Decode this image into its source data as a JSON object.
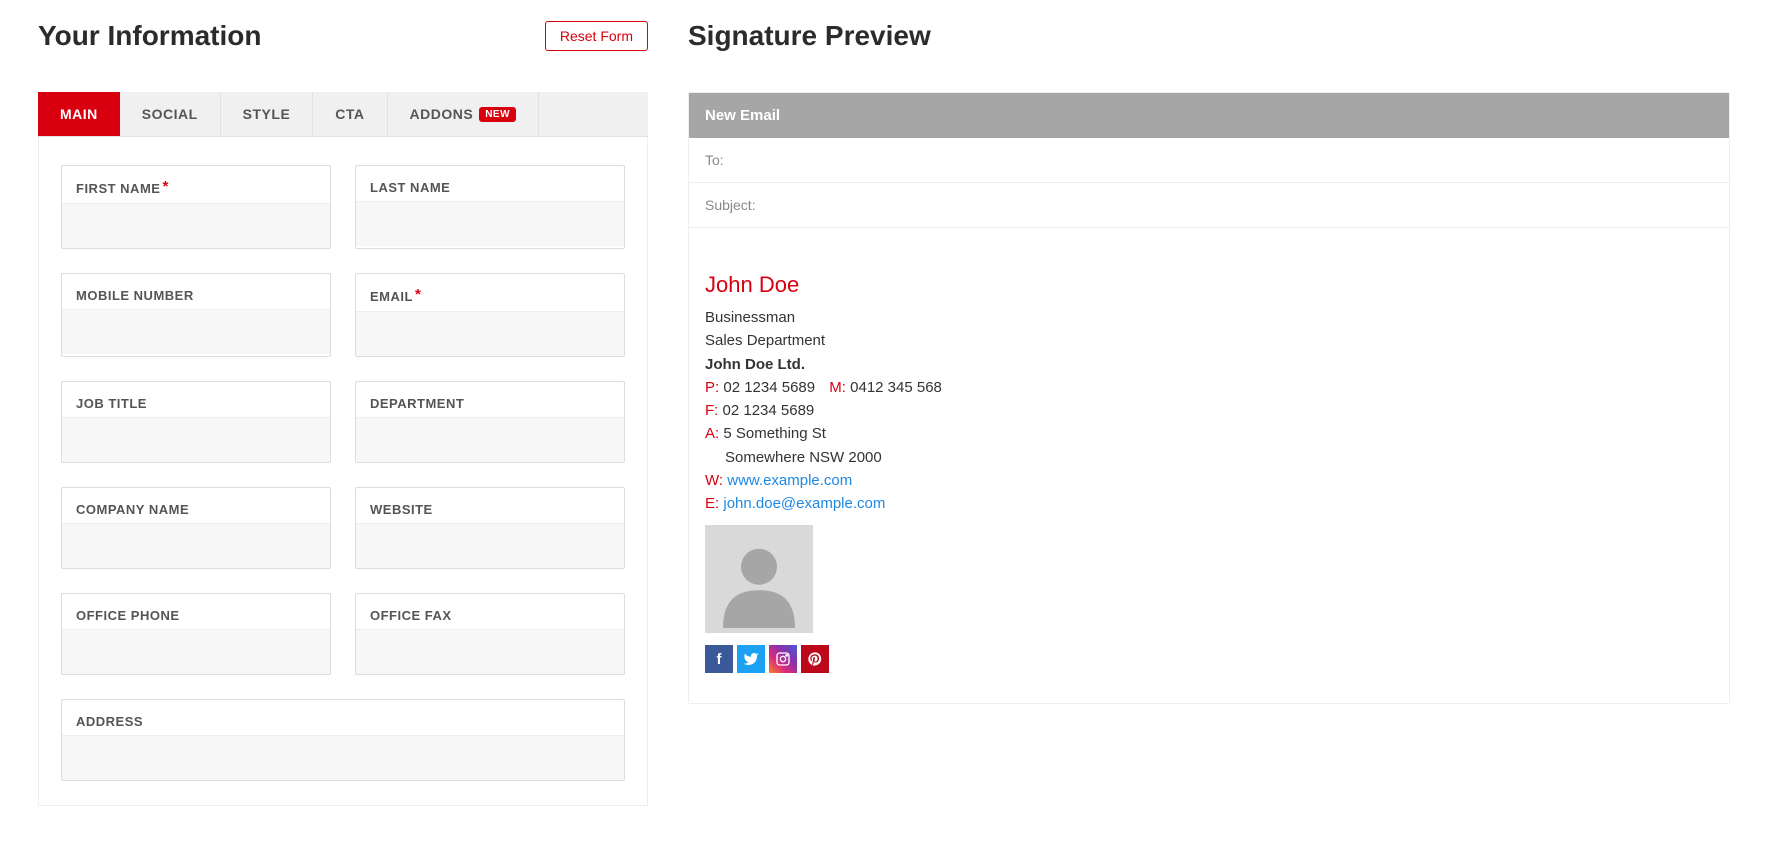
{
  "left": {
    "title": "Your Information",
    "reset": "Reset Form",
    "tabs": [
      {
        "label": "MAIN",
        "active": true,
        "badge": null
      },
      {
        "label": "SOCIAL",
        "active": false,
        "badge": null
      },
      {
        "label": "STYLE",
        "active": false,
        "badge": null
      },
      {
        "label": "CTA",
        "active": false,
        "badge": null
      },
      {
        "label": "ADDONS",
        "active": false,
        "badge": "NEW"
      }
    ],
    "fields": {
      "first_name": "FIRST NAME",
      "last_name": "LAST NAME",
      "mobile_number": "MOBILE NUMBER",
      "email": "EMAIL",
      "job_title": "JOB TITLE",
      "department": "DEPARTMENT",
      "company_name": "COMPANY NAME",
      "website": "WEBSITE",
      "office_phone": "OFFICE PHONE",
      "office_fax": "OFFICE FAX",
      "address": "ADDRESS"
    },
    "required_mark": "*"
  },
  "right": {
    "title": "Signature Preview",
    "new_email": "New Email",
    "to": "To:",
    "subject": "Subject:",
    "signature": {
      "name": "John Doe",
      "job": "Businessman",
      "dept": "Sales Department",
      "company": "John Doe Ltd.",
      "phone_label": "P:",
      "phone": "02 1234 5689",
      "mobile_label": "M:",
      "mobile": "0412 345 568",
      "fax_label": "F:",
      "fax": "02 1234 5689",
      "addr_label": "A:",
      "addr1": "5 Something St",
      "addr2": "Somewhere NSW 2000",
      "web_label": "W:",
      "web": "www.example.com",
      "email_label": "E:",
      "email": "john.doe@example.com"
    }
  }
}
